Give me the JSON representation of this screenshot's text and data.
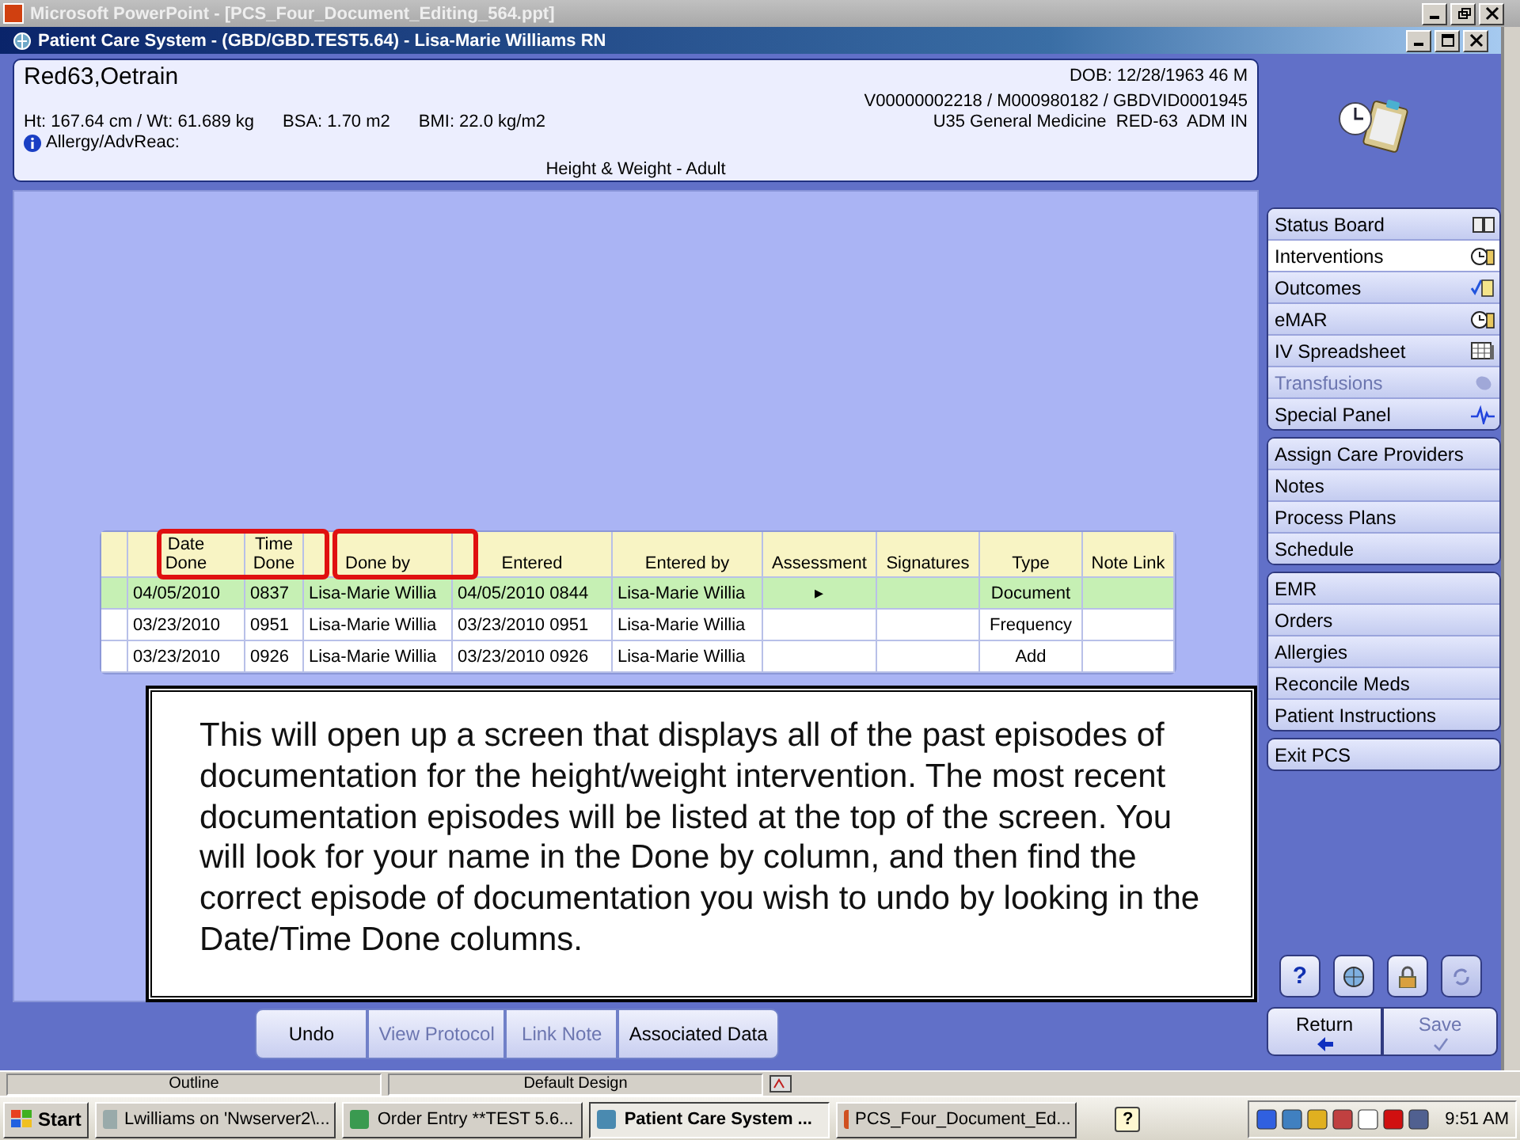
{
  "ppt_window": {
    "title": "Microsoft PowerPoint - [PCS_Four_Document_Editing_564.ppt]"
  },
  "pcs_window": {
    "title": "Patient Care System - (GBD/GBD.TEST5.64) - Lisa-Marie Williams RN"
  },
  "patient": {
    "name": "Red63,Oetrain",
    "dob": "DOB: 12/28/1963 46 M",
    "ids": "V00000002218 / M000980182 / GBDVID0001945",
    "height_weight": "Ht: 167.64 cm / Wt: 61.689 kg",
    "bsa": "BSA: 1.70 m2",
    "bmi": "BMI: 22.0 kg/m2",
    "location": "U35 General Medicine  RED-63  ADM IN",
    "allergy": "Allergy/AdvReac:",
    "subtitle": "Height & Weight - Adult"
  },
  "table": {
    "columns": [
      {},
      {
        "label": "Date Done",
        "highlighted": true
      },
      {
        "label": "Time Done",
        "highlighted": true
      },
      {
        "label": "Done by",
        "highlighted": true
      },
      {
        "label": "Entered",
        "highlighted": false
      },
      {
        "label": "Entered by",
        "highlighted": false
      },
      {
        "label": "Assessment",
        "highlighted": false
      },
      {
        "label": "Signatures",
        "highlighted": false
      },
      {
        "label": "Type",
        "highlighted": false
      },
      {
        "label": "Note Link",
        "highlighted": false
      }
    ],
    "rows": [
      {
        "selected": true,
        "cells": [
          null,
          "04/05/2010",
          "0837",
          "Lisa-Marie Willia",
          "04/05/2010 0844",
          "Lisa-Marie Willia",
          "▸",
          null,
          "Document",
          null
        ]
      },
      {
        "selected": false,
        "cells": [
          null,
          "03/23/2010",
          "0951",
          "Lisa-Marie Willia",
          "03/23/2010 0951",
          "Lisa-Marie Willia",
          null,
          null,
          "Frequency",
          null
        ]
      },
      {
        "selected": false,
        "cells": [
          null,
          "03/23/2010",
          "0926",
          "Lisa-Marie Willia",
          "03/23/2010 0926",
          "Lisa-Marie Willia",
          null,
          null,
          "Add",
          null
        ]
      }
    ]
  },
  "callout": "This will open up a screen that displays all of the past episodes of documentation for the height/weight intervention. The most recent documentation episodes will be listed at the top of the screen. You will look for your name in the Done by column, and then find the correct episode of documentation you wish to undo by looking in the Date/Time Done columns.",
  "nav_groups": [
    {
      "items": [
        {
          "label": "Status Board",
          "selected": false,
          "disabled": false
        },
        {
          "label": "Interventions",
          "selected": true,
          "disabled": false
        },
        {
          "label": "Outcomes",
          "selected": false,
          "disabled": false
        },
        {
          "label": "eMAR",
          "selected": false,
          "disabled": false
        },
        {
          "label": "IV Spreadsheet",
          "selected": false,
          "disabled": false
        },
        {
          "label": "Transfusions",
          "selected": false,
          "disabled": true
        },
        {
          "label": "Special Panel",
          "selected": false,
          "disabled": false
        }
      ]
    },
    {
      "items": [
        {
          "label": "Assign Care Providers",
          "selected": false,
          "disabled": false
        },
        {
          "label": "Notes",
          "selected": false,
          "disabled": false
        },
        {
          "label": "Process Plans",
          "selected": false,
          "disabled": false
        },
        {
          "label": "Schedule",
          "selected": false,
          "disabled": false
        }
      ]
    },
    {
      "items": [
        {
          "label": "EMR",
          "selected": false,
          "disabled": false
        },
        {
          "label": "Orders",
          "selected": false,
          "disabled": false
        },
        {
          "label": "Allergies",
          "selected": false,
          "disabled": false
        },
        {
          "label": "Reconcile Meds",
          "selected": false,
          "disabled": false
        },
        {
          "label": "Patient Instructions",
          "selected": false,
          "disabled": false
        }
      ]
    },
    {
      "items": [
        {
          "label": "Exit PCS",
          "selected": false,
          "disabled": false
        }
      ]
    }
  ],
  "tool_buttons": [
    {
      "kind": "help",
      "label": "?",
      "disabled": false
    },
    {
      "kind": "globe",
      "disabled": false
    },
    {
      "kind": "lock",
      "disabled": false
    },
    {
      "kind": "refresh",
      "disabled": true
    }
  ],
  "action_buttons": [
    {
      "label": "Undo",
      "disabled": false
    },
    {
      "label": "View Protocol",
      "disabled": true
    },
    {
      "label": "Link Note",
      "disabled": true
    },
    {
      "label": "Associated Data",
      "disabled": false
    }
  ],
  "return_save": [
    {
      "kind": "return",
      "label": "Return",
      "disabled": false
    },
    {
      "kind": "save",
      "label": "Save",
      "disabled": true
    }
  ],
  "ppt_status": [
    "Outline",
    "Default Design"
  ],
  "taskbar": {
    "start": "Start",
    "tasks": [
      {
        "label": "Lwilliams on 'Nwserver2\\...",
        "selected": false
      },
      {
        "label": "Order Entry **TEST 5.6...",
        "selected": false
      },
      {
        "label": "Patient Care System ...",
        "selected": true
      },
      {
        "label": "PCS_Four_Document_Ed...",
        "selected": false
      }
    ],
    "help": "?",
    "clock": "9:51 AM"
  }
}
